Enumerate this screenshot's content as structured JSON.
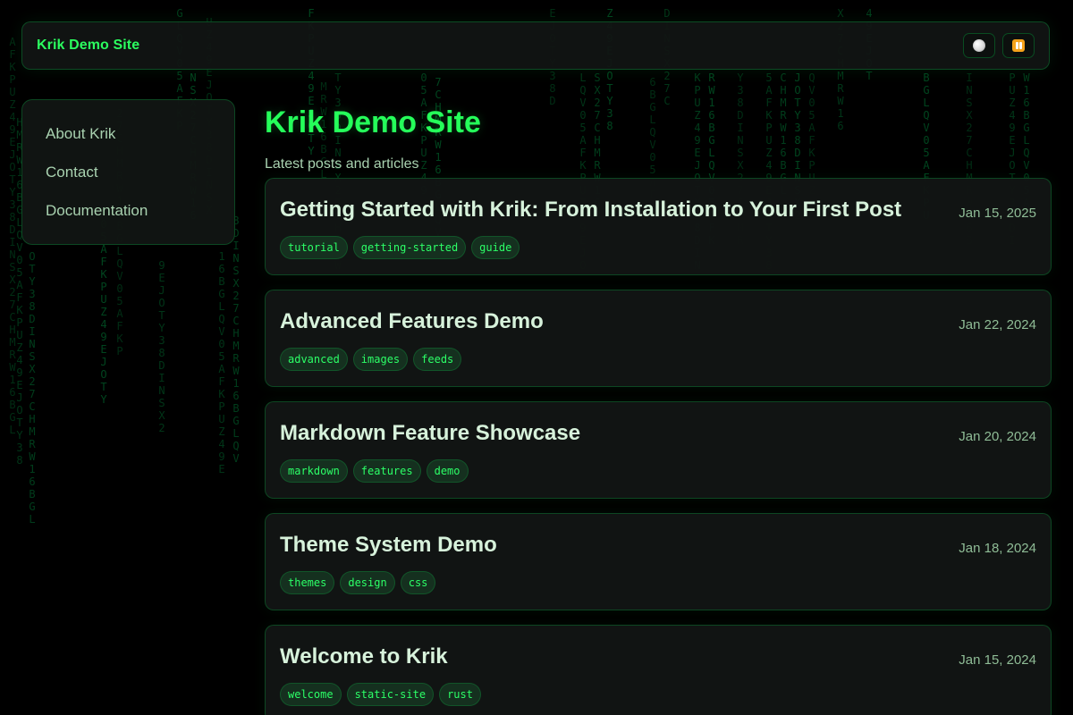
{
  "header": {
    "title": "Krik Demo Site",
    "theme_icon": "circle-icon",
    "pause_icon": "pause-icon"
  },
  "sidebar": {
    "items": [
      {
        "label": "About Krik"
      },
      {
        "label": "Contact"
      },
      {
        "label": "Documentation"
      }
    ]
  },
  "main": {
    "title": "Krik Demo Site",
    "subtitle": "Latest posts and articles"
  },
  "posts": [
    {
      "title": "Getting Started with Krik: From Installation to Your First Post",
      "date": "Jan 15, 2025",
      "tags": [
        "tutorial",
        "getting-started",
        "guide"
      ]
    },
    {
      "title": "Advanced Features Demo",
      "date": "Jan 22, 2024",
      "tags": [
        "advanced",
        "images",
        "feeds"
      ]
    },
    {
      "title": "Markdown Feature Showcase",
      "date": "Jan 20, 2024",
      "tags": [
        "markdown",
        "features",
        "demo"
      ]
    },
    {
      "title": "Theme System Demo",
      "date": "Jan 18, 2024",
      "tags": [
        "themes",
        "design",
        "css"
      ]
    },
    {
      "title": "Welcome to Krik",
      "date": "Jan 15, 2024",
      "tags": [
        "welcome",
        "static-site",
        "rust"
      ]
    }
  ],
  "colors": {
    "accent": "#25ff5a",
    "text": "#d7f2db",
    "muted": "#a9d2b0",
    "tag_bg": "#15301f",
    "tag_text": "#2cff67",
    "card_bg": "#121514",
    "background": "#000000"
  }
}
